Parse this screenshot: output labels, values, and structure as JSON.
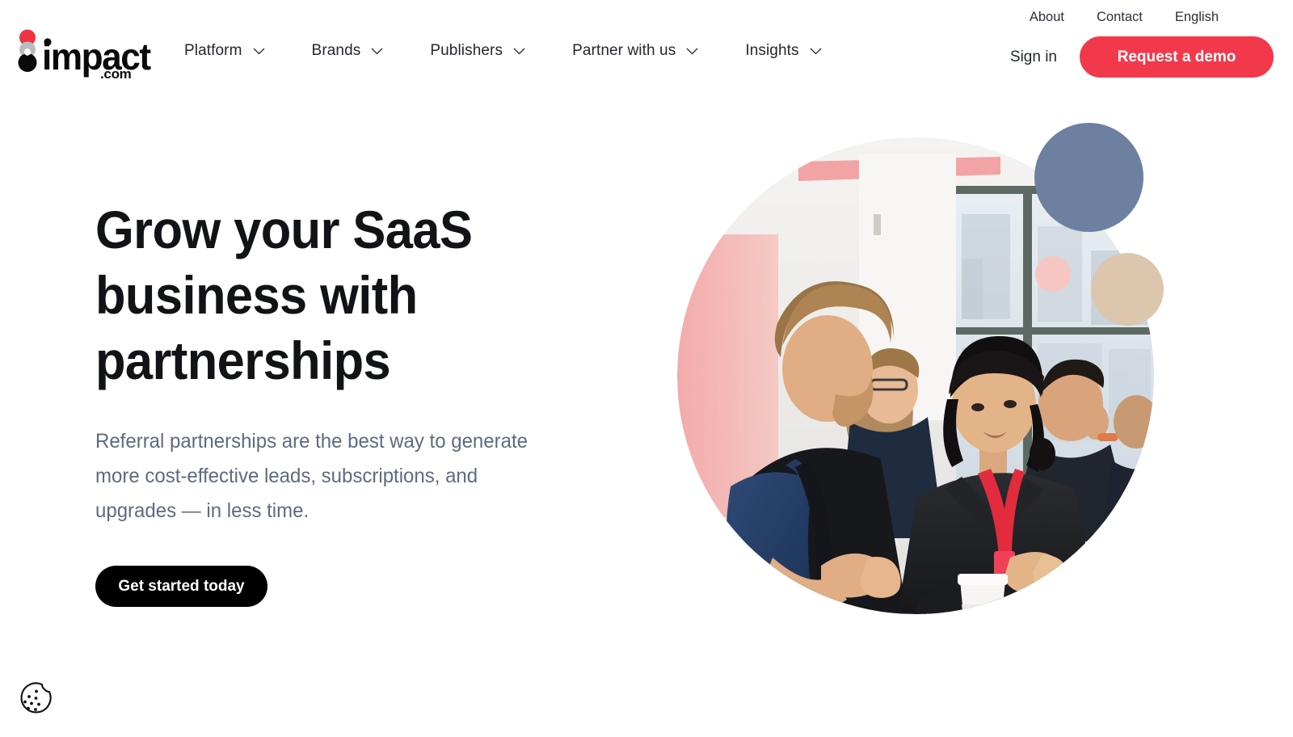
{
  "brand": {
    "logo_name": "impact.com",
    "logo_wordmark": "impact",
    "logo_suffix": ".com",
    "red": "#f2394b",
    "black": "#000000",
    "slate_text": "#5d6b7f"
  },
  "utility_bar": {
    "links": [
      {
        "label": "About"
      },
      {
        "label": "Contact"
      },
      {
        "label": "English"
      }
    ]
  },
  "mainnav": {
    "items": [
      {
        "label": "Platform",
        "has_dropdown": true
      },
      {
        "label": "Brands",
        "has_dropdown": true
      },
      {
        "label": "Publishers",
        "has_dropdown": true
      },
      {
        "label": "Partner with us",
        "has_dropdown": true
      },
      {
        "label": "Insights",
        "has_dropdown": true
      }
    ]
  },
  "header_actions": {
    "signin_label": "Sign in",
    "demo_label": "Request a demo"
  },
  "hero": {
    "title_lines": [
      "Grow your SaaS",
      "business with",
      "partnerships"
    ],
    "title_full": "Grow your SaaS business with partnerships",
    "subtitle": "Referral partnerships are the best way to generate more cost-effective leads, subscriptions, and upgrades — in less time.",
    "cta_label": "Get started today",
    "image_alt": "Colleagues talking at a conference table in a bright office",
    "decorations": [
      {
        "name": "blue-circle",
        "color": "#6d809f"
      },
      {
        "name": "pink-circle",
        "color": "#f6c7c2"
      },
      {
        "name": "tan-circle",
        "color": "#dcc6ae"
      }
    ]
  },
  "cookie_widget": {
    "icon": "cookie-icon"
  }
}
